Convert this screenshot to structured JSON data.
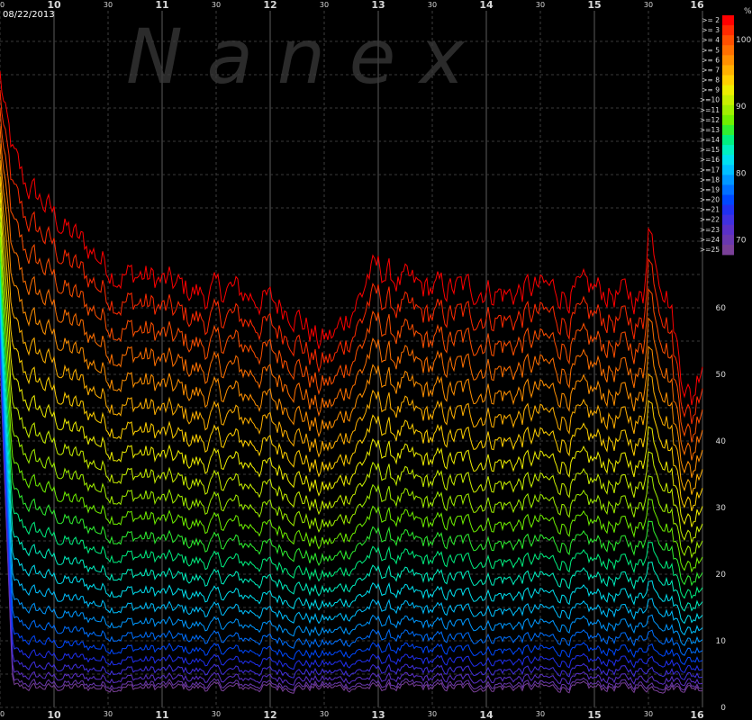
{
  "chart_data": {
    "type": "line",
    "date_label": "08/22/2013",
    "watermark": "N a n e x",
    "x_hour_labels": [
      "10",
      "11",
      "12",
      "13",
      "14",
      "15",
      "16"
    ],
    "x_half_label": "30",
    "y_ticks": [
      "0",
      "10",
      "20",
      "30",
      "40",
      "50",
      "60"
    ],
    "x_range": [
      9.5,
      16.0
    ],
    "y_range": [
      0,
      105
    ],
    "grid": true,
    "legend_placement": "top-right",
    "legend_entries": [
      ">= 2",
      ">= 3",
      ">= 4",
      ">= 5",
      ">= 6",
      ">= 7",
      ">= 8",
      ">= 9",
      ">=10",
      ">=11",
      ">=12",
      ">=13",
      ">=14",
      ">=15",
      ">=16",
      ">=17",
      ">=18",
      ">=19",
      ">=20",
      ">=21",
      ">=22",
      ">=23",
      ">=24",
      ">=25"
    ],
    "legend_scale_ticks": [
      "100",
      "90",
      "80",
      "70"
    ],
    "legend_corner_label": "%",
    "legend_colors": [
      "#ff0000",
      "#ff2a00",
      "#ff5000",
      "#ff7000",
      "#ff9000",
      "#ffb000",
      "#ffd000",
      "#eeee00",
      "#c8f000",
      "#a0f000",
      "#70f000",
      "#30f030",
      "#00f080",
      "#00f0c0",
      "#00e0f0",
      "#00c0ff",
      "#0098ff",
      "#0070ff",
      "#0048ff",
      "#2030f0",
      "#4030e0",
      "#5a30c8",
      "#6a38b0",
      "#7a4098"
    ],
    "series_top_profile": {
      "time": [
        9.5,
        9.55,
        9.62,
        9.72,
        9.83,
        9.95,
        10.1,
        10.25,
        10.4,
        10.6,
        10.8,
        11.0,
        11.2,
        11.4,
        11.6,
        11.8,
        12.0,
        12.2,
        12.35,
        12.45,
        12.6,
        12.75,
        12.85,
        12.9,
        13.0,
        13.2,
        13.4,
        13.6,
        13.8,
        14.0,
        14.2,
        14.4,
        14.6,
        14.8,
        15.0,
        15.2,
        15.35,
        15.45,
        15.5,
        15.6,
        15.7,
        15.8,
        15.9,
        16.0
      ],
      "value": [
        91,
        86,
        82,
        78,
        76,
        74,
        71,
        69,
        67,
        64,
        64,
        63,
        62,
        61,
        62,
        61,
        60,
        59,
        56,
        54,
        55,
        59,
        61,
        64,
        65,
        63,
        62,
        62,
        62,
        62,
        61,
        62,
        62,
        61,
        62,
        61,
        61,
        60,
        72,
        65,
        60,
        50,
        45,
        52
      ]
    }
  }
}
